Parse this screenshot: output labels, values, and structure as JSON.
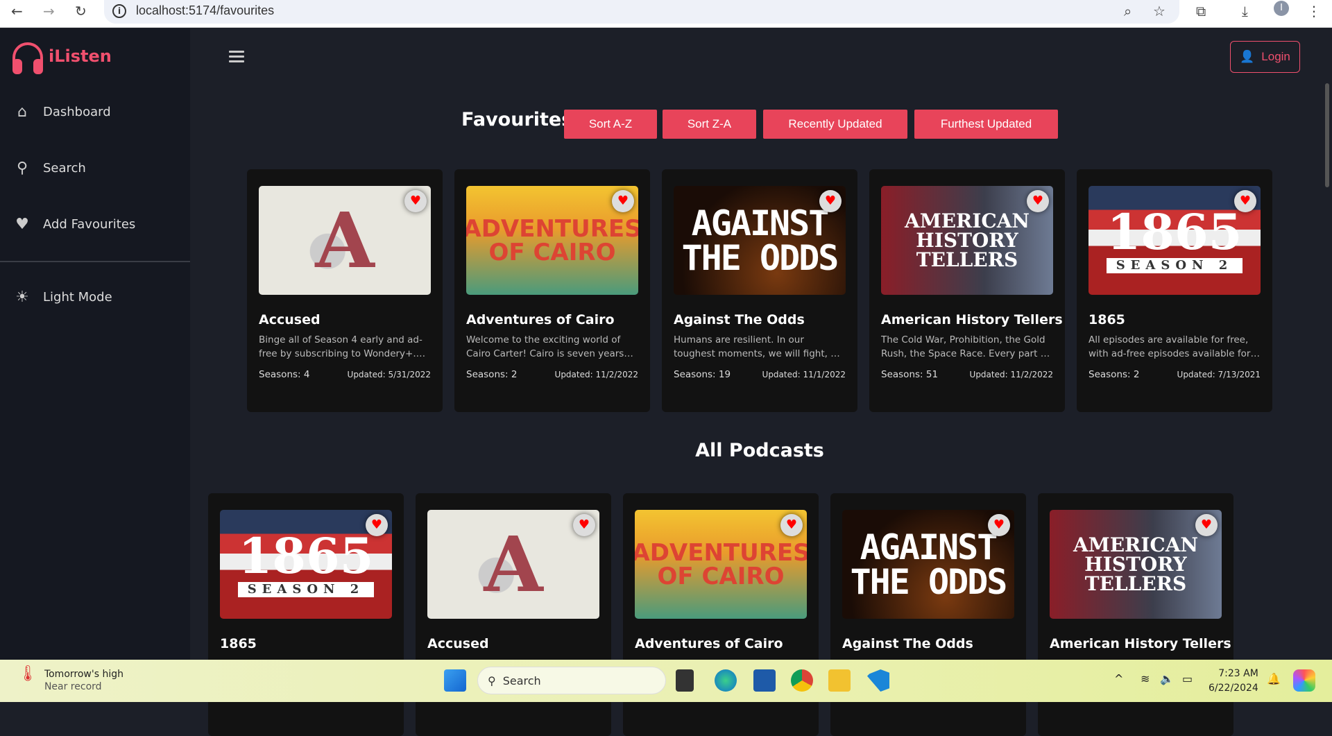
{
  "browser": {
    "url": "localhost:5174/favourites"
  },
  "app": {
    "name": "iListen",
    "login_label": "Login"
  },
  "sidebar": {
    "items": [
      {
        "label": "Dashboard",
        "icon": "home-icon"
      },
      {
        "label": "Search",
        "icon": "search-icon"
      },
      {
        "label": "Add Favourites",
        "icon": "heart-icon"
      },
      {
        "label": "Light Mode",
        "icon": "sun-icon"
      }
    ]
  },
  "favourites": {
    "title": "Favourites",
    "sort_buttons": [
      "Sort A-Z",
      "Sort Z-A",
      "Recently Updated",
      "Furthest Updated"
    ],
    "cards": [
      {
        "title": "Accused",
        "art": "A",
        "desc": "Binge all of Season 4 early and ad-free by subscribing to Wondery+. Experience a new way to enjoy true crime",
        "seasons": "Seasons: 4",
        "updated": "Updated: 5/31/2022"
      },
      {
        "title": "Adventures of Cairo",
        "art": "ADVENTURES OF CAIRO",
        "desc": "Welcome to the exciting world of Cairo Carter! Cairo is seven years old",
        "seasons": "Seasons: 2",
        "updated": "Updated: 11/2/2022"
      },
      {
        "title": "Against The Odds",
        "art": "AGAINST THE ODDS",
        "desc": "Humans are resilient. In our toughest moments, we will fight, we will endure",
        "seasons": "Seasons: 19",
        "updated": "Updated: 11/1/2022"
      },
      {
        "title": "American History Tellers",
        "art": "AMERICAN HISTORY TELLERS",
        "desc": "The Cold War, Prohibition, the Gold Rush, the Space Race. Every part of our history",
        "seasons": "Seasons: 51",
        "updated": "Updated: 11/2/2022"
      },
      {
        "title": "1865",
        "art": "1865",
        "art_sub": "SEASON 2",
        "desc": "All episodes are available for free, with ad-free episodes available for subscribers",
        "seasons": "Seasons: 2",
        "updated": "Updated: 7/13/2021"
      }
    ]
  },
  "all_podcasts": {
    "title": "All Podcasts",
    "cards": [
      {
        "title": "1865",
        "art": "1865",
        "art_sub": "SEASON 2"
      },
      {
        "title": "Accused",
        "art": "A"
      },
      {
        "title": "Adventures of Cairo",
        "art": "ADVENTURES OF CAIRO"
      },
      {
        "title": "Against The Odds",
        "art": "AGAINST THE ODDS"
      },
      {
        "title": "American History Tellers",
        "art": "AMERICAN HISTORY TELLERS"
      }
    ]
  },
  "taskbar": {
    "weather_title": "Tomorrow's high",
    "weather_sub": "Near record",
    "search_label": "Search",
    "time": "7:23 AM",
    "date": "6/22/2024"
  },
  "colors": {
    "accent": "#e8445a",
    "logo": "#f0506e",
    "sidebar": "#151821",
    "main": "#1c1f28",
    "card": "#121212"
  }
}
